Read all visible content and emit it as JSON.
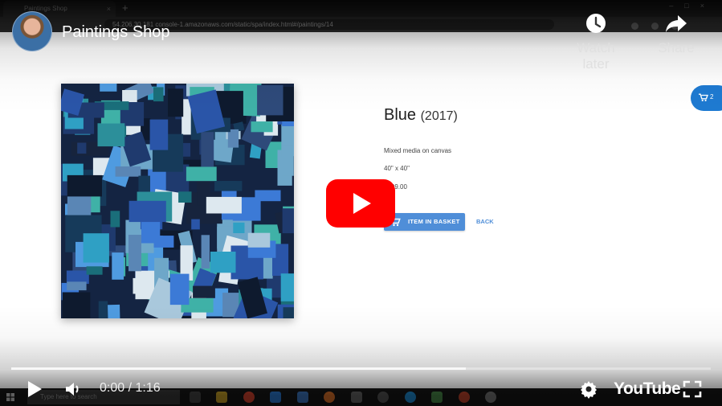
{
  "browser": {
    "tab_title": "Paintings Shop",
    "tab_close": "×",
    "new_tab": "+",
    "url": "54.206.30.181 console-1.amazonaws.com/static/spa/index.html#/paintings/14"
  },
  "header": {
    "title": "Paintings Shop",
    "watch_later": "Watch later",
    "share": "Share"
  },
  "artwork": {
    "title": "Blue",
    "year": "(2017)",
    "medium": "Mixed media on canvas",
    "size": "40\" x 40\"",
    "price": "$599.00",
    "basket_button": "ITEM IN BASKET",
    "back_button": "BACK"
  },
  "basket": {
    "count": "2"
  },
  "player": {
    "time": "0:00 / 1:16",
    "logo": "YouTube",
    "loaded_fraction": 0.65
  },
  "taskbar": {
    "search_placeholder": "Type here to search"
  },
  "colors": {
    "accent_blue": "#4f8ed8",
    "fab_blue": "#1e7ad1",
    "play_red": "#ff0000"
  }
}
